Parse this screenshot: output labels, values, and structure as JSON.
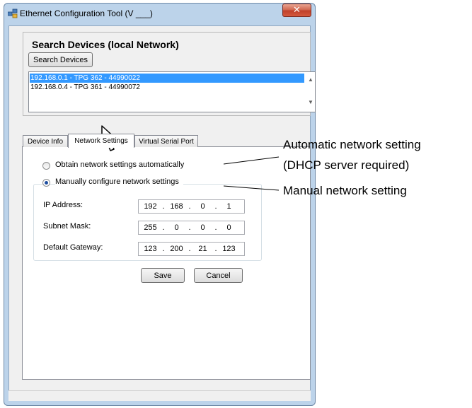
{
  "window": {
    "title": "Ethernet Configuration Tool (V ___)"
  },
  "search": {
    "group_title": "Search Devices (local Network)",
    "button_label": "Search Devices",
    "devices": [
      {
        "label": "192.168.0.1 - TPG 362 - 44990022",
        "selected": true
      },
      {
        "label": "192.168.0.4 - TPG 361 - 44990072",
        "selected": false
      }
    ]
  },
  "tabs": [
    {
      "label": "Device Info",
      "active": false
    },
    {
      "label": "Network Settings",
      "active": true
    },
    {
      "label": "Virtual Serial Port",
      "active": false
    }
  ],
  "network": {
    "auto_option_label": "Obtain network settings automatically",
    "manual_option_label": "Manually configure network settings",
    "selected_option": "manual",
    "fields": [
      {
        "label": "IP Address:",
        "octets": [
          "192",
          "168",
          "0",
          "1"
        ]
      },
      {
        "label": "Subnet Mask:",
        "octets": [
          "255",
          "0",
          "0",
          "0"
        ]
      },
      {
        "label": "Default Gateway:",
        "octets": [
          "123",
          "200",
          "21",
          "123"
        ]
      }
    ],
    "save_label": "Save",
    "cancel_label": "Cancel"
  },
  "callouts": {
    "automatic_line1": "Automatic network setting",
    "automatic_line2": "(DHCP server required)",
    "manual": "Manual network setting"
  },
  "colors": {
    "selection": "#3399ff",
    "close_button": "#c9452f",
    "window_frame": "#bcd3ea"
  },
  "icons": [
    "app-icon",
    "close-icon",
    "mouse-cursor-icon",
    "scroll-up-icon",
    "scroll-down-icon"
  ]
}
